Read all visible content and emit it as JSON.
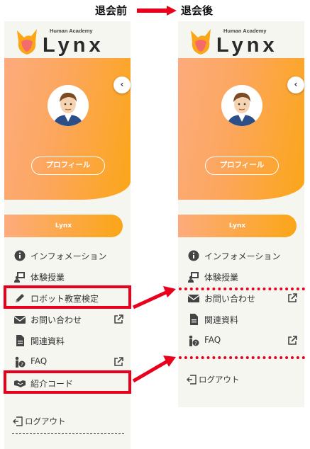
{
  "header": {
    "before_label": "退会前",
    "after_label": "退会後"
  },
  "logo": {
    "sub": "Human Academy",
    "main": "Lynx"
  },
  "profile_button": "プロフィール",
  "collapse_glyph": "‹",
  "lynx_bar": "Lynx",
  "before_menu": [
    {
      "label": "インフォメーション"
    },
    {
      "label": "体験授業"
    },
    {
      "label": "ロボット教室検定"
    },
    {
      "label": "お問い合わせ"
    },
    {
      "label": "関連資料"
    },
    {
      "label": "FAQ"
    },
    {
      "label": "紹介コード"
    }
  ],
  "after_menu": [
    {
      "label": "インフォメーション"
    },
    {
      "label": "体験授業"
    },
    {
      "label": "お問い合わせ"
    },
    {
      "label": "関連資料"
    },
    {
      "label": "FAQ"
    }
  ],
  "logout_label": "ログアウト",
  "colors": {
    "accent_red": "#e8001c",
    "gradient_start": "#fdab7d",
    "gradient_end": "#fba617"
  }
}
